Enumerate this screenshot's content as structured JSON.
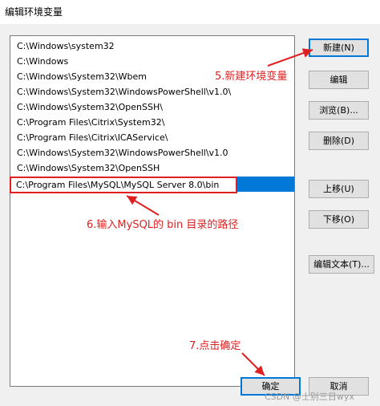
{
  "window": {
    "title": "编辑环境变量"
  },
  "list": {
    "items": [
      "C:\\Windows\\system32",
      "C:\\Windows",
      "C:\\Windows\\System32\\Wbem",
      "C:\\Windows\\System32\\WindowsPowerShell\\v1.0\\",
      "C:\\Windows\\System32\\OpenSSH\\",
      "C:\\Program Files\\Citrix\\System32\\",
      "C:\\Program Files\\Citrix\\ICAService\\",
      "C:\\Windows\\System32\\WindowsPowerShell\\v1.0",
      "C:\\Windows\\System32\\OpenSSH"
    ],
    "editing_value": "C:\\Program Files\\MySQL\\MySQL Server 8.0\\bin"
  },
  "buttons": {
    "new": "新建(N)",
    "edit": "编辑",
    "browse": "浏览(B)...",
    "delete": "删除(D)",
    "move_up": "上移(U)",
    "move_down": "下移(O)",
    "edit_text": "编辑文本(T)...",
    "ok": "确定",
    "cancel": "取消"
  },
  "annotations": {
    "step5": "5.新建环境变量",
    "step6": "6.输入MySQL的 bin 目录的路径",
    "step7": "7.点击确定",
    "color": "#e02020"
  },
  "watermark": "CSDN @士别三日wyx"
}
